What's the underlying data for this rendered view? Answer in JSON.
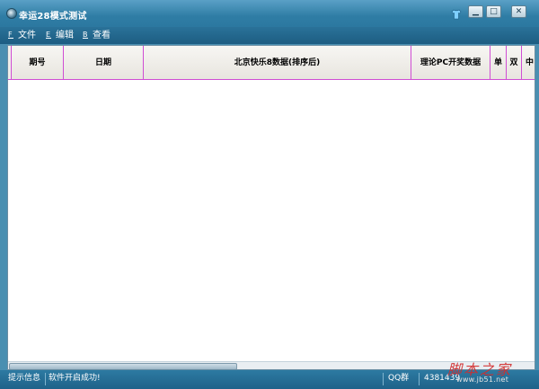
{
  "window": {
    "title": "幸运28模式测试",
    "controls": {
      "minimize": "▁",
      "maximize": "□",
      "close": "✕"
    }
  },
  "menu": {
    "items": [
      {
        "key": "F",
        "label": "文件"
      },
      {
        "key": "E",
        "label": "编辑"
      },
      {
        "key": "B",
        "label": "查看"
      }
    ]
  },
  "grid": {
    "columns": [
      "期号",
      "日期",
      "北京快乐8数据(排序后)",
      "理论PC开奖数据",
      "单",
      "双",
      "中"
    ],
    "rows": []
  },
  "scrollbar": {
    "position": 0.44
  },
  "status": {
    "label": "提示信息",
    "message": "软件开启成功!",
    "qq_label": "QQ群",
    "qq_number": "4381439"
  },
  "watermark": {
    "main": "脚本之家",
    "sub": "www.jb51.net"
  },
  "colors": {
    "titlebar": "#2f7da5",
    "menubar": "#1d5d82",
    "grid_border": "#d04dd4",
    "statusbar": "#1f6289"
  }
}
